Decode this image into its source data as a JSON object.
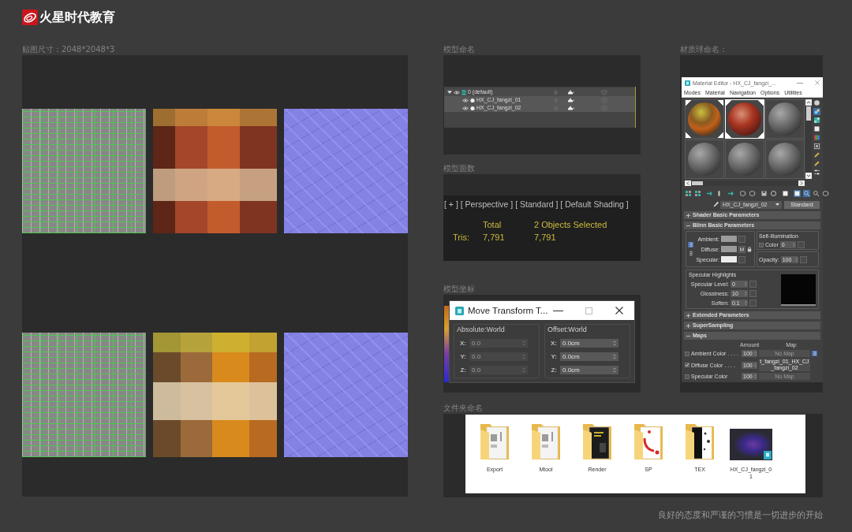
{
  "header": {
    "brand": "火星时代教育"
  },
  "texture_panel": {
    "label": "贴图尺寸：2048*2048*3",
    "textures": [
      {
        "kind": "uv_layout"
      },
      {
        "kind": "diffuse"
      },
      {
        "kind": "normal"
      },
      {
        "kind": "uv_layout"
      },
      {
        "kind": "diffuse"
      },
      {
        "kind": "normal"
      }
    ]
  },
  "naming_panel": {
    "label": "模型命名",
    "outliner": [
      {
        "kind": "layer",
        "name": "0 (default)",
        "expanded": true,
        "selected": false,
        "children": [
          {
            "kind": "object",
            "name": "HX_CJ_fangzi_01",
            "selected": true
          },
          {
            "kind": "object",
            "name": "HX_CJ_fangzi_02",
            "selected": true
          }
        ]
      }
    ]
  },
  "faces_panel": {
    "label": "模型面数",
    "viewport_label": "[ + ] [ Perspective ] [ Standard ] [ Default Shading ]",
    "stats": {
      "columns": [
        "Total",
        "2 Objects Selected"
      ],
      "rows": [
        {
          "label": "Tris:",
          "values": [
            "7,791",
            "7,791"
          ]
        }
      ]
    }
  },
  "coords_panel": {
    "label": "模型坐标",
    "dialog": {
      "title": "Move Transform T...",
      "groups": [
        {
          "title": "Absolute:World",
          "fields": [
            {
              "axis": "X:",
              "value": "0.0",
              "disabled": true
            },
            {
              "axis": "Y:",
              "value": "0.0",
              "disabled": true
            },
            {
              "axis": "Z:",
              "value": "0.0",
              "disabled": true
            }
          ]
        },
        {
          "title": "Offset:World",
          "fields": [
            {
              "axis": "X:",
              "value": "0.0cm",
              "disabled": false
            },
            {
              "axis": "Y:",
              "value": "0.0cm",
              "disabled": false
            },
            {
              "axis": "Z:",
              "value": "0.0cm",
              "disabled": false
            }
          ]
        }
      ]
    }
  },
  "material_panel": {
    "label": "材质球命名：",
    "editor": {
      "title": "Material Editor - HX_CJ_fangzi_...",
      "menu": [
        "Modes",
        "Material",
        "Navigation",
        "Options",
        "Utilities"
      ],
      "slots": [
        {
          "kind": "textured",
          "hot": true,
          "selected": false
        },
        {
          "kind": "textured",
          "hot": true,
          "selected": true
        },
        {
          "kind": "blank",
          "hot": false,
          "selected": false
        },
        {
          "kind": "blank",
          "hot": false,
          "selected": false
        },
        {
          "kind": "blank",
          "hot": false,
          "selected": false
        },
        {
          "kind": "blank",
          "hot": false,
          "selected": false
        }
      ],
      "side_toolbar": [
        {
          "on": false
        },
        {
          "on": true
        },
        {
          "on": false
        },
        {
          "on": false
        },
        {
          "on": false
        },
        {
          "on": false
        },
        {
          "on": false
        },
        {
          "on": false
        },
        {
          "on": false
        }
      ],
      "toolbar": [
        {
          "on": false
        },
        {
          "on": false
        },
        {
          "on": false
        },
        {
          "on": false
        },
        {
          "on": false
        },
        {
          "on": false
        },
        {
          "on": false
        },
        {
          "on": false
        },
        {
          "on": false
        },
        {
          "on": false
        },
        {
          "on": true
        },
        {
          "on": true
        },
        {
          "on": false
        },
        {
          "on": false
        }
      ],
      "material_name": "HX_CJ_fangzi_02",
      "material_type": "Standard",
      "rollouts": [
        {
          "title": "Shader Basic Parameters",
          "expanded": false
        },
        {
          "kind": "blinn",
          "title": "Blinn Basic Parameters",
          "expanded": true,
          "locks": [
            {
              "on": true
            },
            {
              "on": false
            }
          ],
          "colors": [
            {
              "label": "Ambient:",
              "color": "#9b9b9b"
            },
            {
              "label": "Diffuse:",
              "color": "#9b9b9b",
              "map_button": "M"
            },
            {
              "label": "Specular:",
              "color": "#ededed"
            }
          ],
          "self_illumination": {
            "title": "Self-Illumination",
            "label": "Color",
            "checked": false,
            "value": "0"
          },
          "opacity": {
            "label": "Opacity:",
            "value": "100"
          },
          "highlights": {
            "title": "Specular Highlights",
            "params": [
              {
                "label": "Specular Level:",
                "value": "0"
              },
              {
                "label": "Glossiness:",
                "value": "10"
              },
              {
                "label": "Soften:",
                "value": "0.1"
              }
            ]
          }
        },
        {
          "title": "Extended Parameters",
          "expanded": false
        },
        {
          "title": "SuperSampling",
          "expanded": false
        },
        {
          "kind": "maps",
          "title": "Maps",
          "expanded": true,
          "columns": [
            "Amount",
            "Map"
          ],
          "rows": [
            {
              "name": "Ambient Color . . . .",
              "checked": false,
              "amount": "100",
              "map": "No Map"
            },
            {
              "name": "Diffuse Color . . . .",
              "checked": true,
              "amount": "100",
              "map": "t_fangzi_01_HX_CJ_fangzi_02"
            },
            {
              "name": "Specular Color",
              "checked": false,
              "amount": "100",
              "map": "No Map"
            }
          ]
        }
      ]
    }
  },
  "folders_panel": {
    "label": "文件夹命名",
    "items": [
      {
        "kind": "folder",
        "name": "Export"
      },
      {
        "kind": "folder",
        "name": "Mtool"
      },
      {
        "kind": "dark_folder",
        "name": "Render"
      },
      {
        "kind": "logo_folder",
        "name": "SP"
      },
      {
        "kind": "mono_folder",
        "name": "TEX"
      },
      {
        "kind": "scene_file",
        "name": "HX_CJ_fangzi_01"
      }
    ]
  },
  "footer": {
    "motto": "良好的态度和严谨的习惯是一切进步的开始"
  }
}
